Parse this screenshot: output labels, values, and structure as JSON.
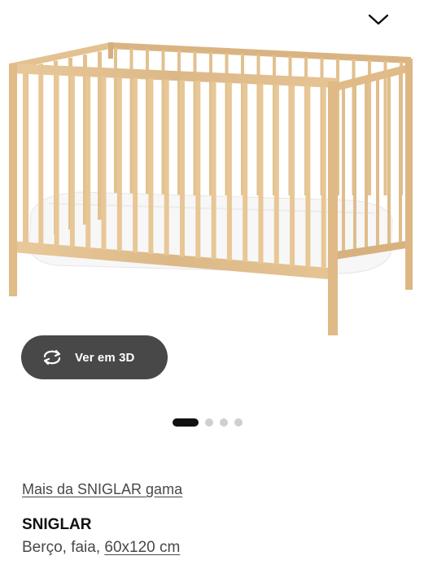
{
  "gallery": {
    "image_alt": "SNIGLAR Berço, faia",
    "collapse_icon": "chevron-down-icon",
    "view3d_icon": "rotate-3d-icon",
    "view3d_label": "Ver em 3D",
    "page_count": 4,
    "active_index": 0
  },
  "product": {
    "range_link": "Mais da SNIGLAR gama",
    "name": "SNIGLAR",
    "desc_prefix": "Berço, faia, ",
    "size": "60x120 cm"
  },
  "colors": {
    "wood": "#e3c08f",
    "accent_button": "#484848",
    "active_dot": "#111111",
    "inactive_dot": "#cfcfcf"
  }
}
